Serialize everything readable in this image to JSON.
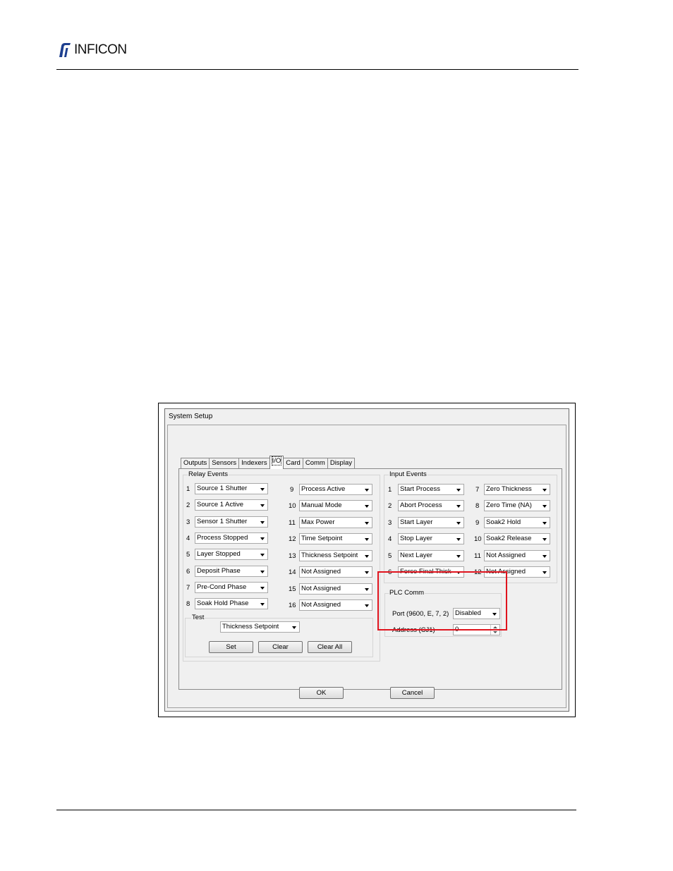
{
  "header": {
    "brand": "INFICON"
  },
  "dialog": {
    "title": "System Setup",
    "tabs": [
      {
        "label": "Outputs"
      },
      {
        "label": "Sensors"
      },
      {
        "label": "Indexers"
      },
      {
        "label": "I/O",
        "active": true
      },
      {
        "label": "Card"
      },
      {
        "label": "Comm"
      },
      {
        "label": "Display"
      }
    ],
    "relay_events": {
      "label": "Relay Events",
      "left": [
        {
          "num": "1",
          "value": "Source 1 Shutter"
        },
        {
          "num": "2",
          "value": "Source 1 Active"
        },
        {
          "num": "3",
          "value": "Sensor 1 Shutter"
        },
        {
          "num": "4",
          "value": "Process Stopped"
        },
        {
          "num": "5",
          "value": "Layer Stopped"
        },
        {
          "num": "6",
          "value": "Deposit Phase"
        },
        {
          "num": "7",
          "value": "Pre-Cond Phase"
        },
        {
          "num": "8",
          "value": "Soak Hold Phase"
        }
      ],
      "right": [
        {
          "num": "9",
          "value": "Process Active"
        },
        {
          "num": "10",
          "value": "Manual Mode"
        },
        {
          "num": "11",
          "value": "Max Power"
        },
        {
          "num": "12",
          "value": "Time Setpoint"
        },
        {
          "num": "13",
          "value": "Thickness Setpoint"
        },
        {
          "num": "14",
          "value": "Not Assigned"
        },
        {
          "num": "15",
          "value": "Not Assigned"
        },
        {
          "num": "16",
          "value": "Not Assigned"
        }
      ]
    },
    "test": {
      "label": "Test",
      "selected": "Thickness Setpoint",
      "set_label": "Set",
      "clear_label": "Clear",
      "clear_all_label": "Clear All"
    },
    "input_events": {
      "label": "Input Events",
      "left": [
        {
          "num": "1",
          "value": "Start Process"
        },
        {
          "num": "2",
          "value": "Abort Process"
        },
        {
          "num": "3",
          "value": "Start Layer"
        },
        {
          "num": "4",
          "value": "Stop Layer"
        },
        {
          "num": "5",
          "value": "Next Layer"
        },
        {
          "num": "6",
          "value": "Force Final Thick"
        }
      ],
      "right": [
        {
          "num": "7",
          "value": "Zero Thickness"
        },
        {
          "num": "8",
          "value": "Zero Time (NA)"
        },
        {
          "num": "9",
          "value": "Soak2 Hold"
        },
        {
          "num": "10",
          "value": "Soak2 Release"
        },
        {
          "num": "11",
          "value": "Not Assigned"
        },
        {
          "num": "12",
          "value": "Not Assigned"
        }
      ]
    },
    "plc_comm": {
      "label": "PLC Comm",
      "port_label": "Port (9600, E, 7, 2)",
      "port_value": "Disabled",
      "address_label": "Address (CJ1)",
      "address_value": "0"
    },
    "ok_label": "OK",
    "cancel_label": "Cancel"
  },
  "colors": {
    "highlight": "#e0141e",
    "dialog_bg": "#f0f0f0"
  }
}
